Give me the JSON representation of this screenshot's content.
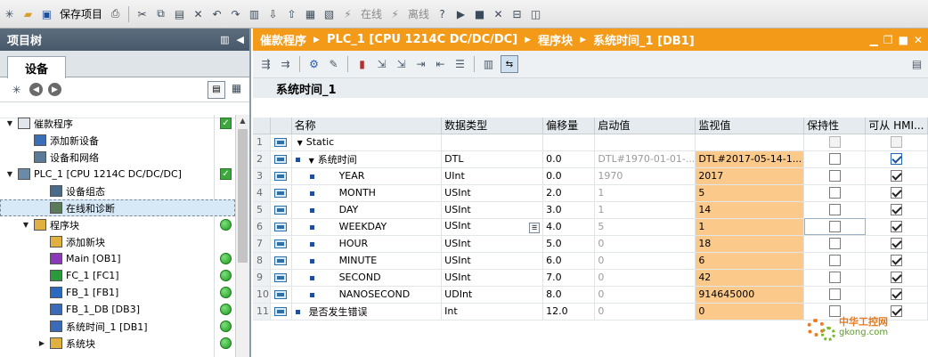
{
  "toolbar": {
    "save_label": "保存项目",
    "online_label": "在线",
    "offline_label": "离线"
  },
  "project_tree": {
    "title": "项目树",
    "tab_devices": "设备",
    "items": [
      {
        "label": "催款程序",
        "indent": 0,
        "arrow": "▼",
        "icon": "project-icon",
        "status": "check"
      },
      {
        "label": "添加新设备",
        "indent": 1,
        "arrow": "",
        "icon": "add-device-icon",
        "status": ""
      },
      {
        "label": "设备和网络",
        "indent": 1,
        "arrow": "",
        "icon": "network-icon",
        "status": ""
      },
      {
        "label": "PLC_1 [CPU 1214C DC/DC/DC]",
        "indent": 0,
        "arrow": "▼",
        "icon": "plc-icon",
        "status": "check"
      },
      {
        "label": "设备组态",
        "indent": 2,
        "arrow": "",
        "icon": "device-config-icon",
        "status": ""
      },
      {
        "label": "在线和诊断",
        "indent": 2,
        "arrow": "",
        "icon": "diagnostics-icon",
        "status": "",
        "selected": true
      },
      {
        "label": "程序块",
        "indent": 1,
        "arrow": "▼",
        "icon": "folder-icon",
        "status": "dot"
      },
      {
        "label": "添加新块",
        "indent": 2,
        "arrow": "",
        "icon": "add-block-icon",
        "status": ""
      },
      {
        "label": "Main [OB1]",
        "indent": 2,
        "arrow": "",
        "icon": "ob-icon",
        "status": "dot"
      },
      {
        "label": "FC_1 [FC1]",
        "indent": 2,
        "arrow": "",
        "icon": "fc-icon",
        "status": "dot"
      },
      {
        "label": "FB_1 [FB1]",
        "indent": 2,
        "arrow": "",
        "icon": "fb-icon",
        "status": "dot"
      },
      {
        "label": "FB_1_DB [DB3]",
        "indent": 2,
        "arrow": "",
        "icon": "db-icon",
        "status": "dot"
      },
      {
        "label": "系统时间_1 [DB1]",
        "indent": 2,
        "arrow": "",
        "icon": "db-icon",
        "status": "dot"
      },
      {
        "label": "系统块",
        "indent": 2,
        "arrow": "▶",
        "icon": "folder-icon",
        "status": "dot"
      }
    ]
  },
  "editor": {
    "breadcrumb": [
      "催款程序",
      "PLC_1 [CPU 1214C DC/DC/DC]",
      "程序块",
      "系统时间_1 [DB1]"
    ],
    "db_name": "系统时间_1",
    "columns": [
      "名称",
      "数据类型",
      "偏移量",
      "启动值",
      "监视值",
      "保持性",
      "可从 HMI..."
    ],
    "rows": [
      {
        "num": "1",
        "level": 0,
        "arrow": "▼",
        "bullet": false,
        "name": "Static",
        "type": "",
        "offset": "",
        "start": "",
        "monitor": "",
        "retain": "dis",
        "hmi": "dis"
      },
      {
        "num": "2",
        "level": 1,
        "arrow": "▼",
        "bullet": true,
        "name": "系统时间",
        "type": "DTL",
        "offset": "0.0",
        "start": "DTL#1970-01-01-...",
        "monitor": "DTL#2017-05-14-1...",
        "retain": "off",
        "hmi": "on-blue"
      },
      {
        "num": "3",
        "level": 2,
        "arrow": "",
        "bullet": true,
        "name": "YEAR",
        "type": "UInt",
        "offset": "0.0",
        "start": "1970",
        "monitor": "2017",
        "retain": "off",
        "hmi": "on"
      },
      {
        "num": "4",
        "level": 2,
        "arrow": "",
        "bullet": true,
        "name": "MONTH",
        "type": "USInt",
        "offset": "2.0",
        "start": "1",
        "monitor": "5",
        "retain": "off",
        "hmi": "on"
      },
      {
        "num": "5",
        "level": 2,
        "arrow": "",
        "bullet": true,
        "name": "DAY",
        "type": "USInt",
        "offset": "3.0",
        "start": "1",
        "monitor": "14",
        "retain": "off",
        "hmi": "on"
      },
      {
        "num": "6",
        "level": 2,
        "arrow": "",
        "bullet": true,
        "name": "WEEKDAY",
        "type": "USInt",
        "offset": "4.0",
        "start": "5",
        "monitor": "1",
        "retain": "off",
        "hmi": "on",
        "editing": true
      },
      {
        "num": "7",
        "level": 2,
        "arrow": "",
        "bullet": true,
        "name": "HOUR",
        "type": "USInt",
        "offset": "5.0",
        "start": "0",
        "monitor": "18",
        "retain": "off",
        "hmi": "on"
      },
      {
        "num": "8",
        "level": 2,
        "arrow": "",
        "bullet": true,
        "name": "MINUTE",
        "type": "USInt",
        "offset": "6.0",
        "start": "0",
        "monitor": "6",
        "retain": "off",
        "hmi": "on"
      },
      {
        "num": "9",
        "level": 2,
        "arrow": "",
        "bullet": true,
        "name": "SECOND",
        "type": "USInt",
        "offset": "7.0",
        "start": "0",
        "monitor": "42",
        "retain": "off",
        "hmi": "on"
      },
      {
        "num": "10",
        "level": 2,
        "arrow": "",
        "bullet": true,
        "name": "NANOSECOND",
        "type": "UDInt",
        "offset": "8.0",
        "start": "0",
        "monitor": "914645000",
        "retain": "off",
        "hmi": "on"
      },
      {
        "num": "11",
        "level": 1,
        "arrow": "",
        "bullet": true,
        "name": "是否发生错误",
        "type": "Int",
        "offset": "12.0",
        "start": "0",
        "monitor": "0",
        "retain": "off",
        "hmi": "on"
      }
    ]
  },
  "watermark": {
    "cn": "中华工控网",
    "url": "gkong.com"
  },
  "colors": {
    "accent": "#f39a18",
    "monitor_bg": "#fbc98a",
    "status_green": "#3da63d"
  }
}
